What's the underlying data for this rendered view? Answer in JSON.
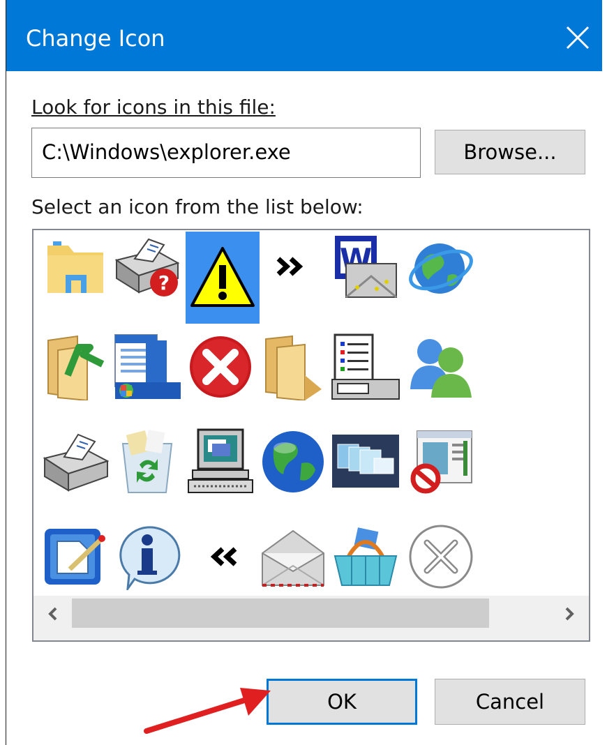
{
  "dialog": {
    "title": "Change Icon",
    "look_for_label": "Look for icons in this file:",
    "file_path": "C:\\Windows\\explorer.exe",
    "browse_label": "Browse...",
    "select_label": "Select an icon from the list below:",
    "ok_label": "OK",
    "cancel_label": "Cancel"
  },
  "icons": [
    [
      "folder-navigation-icon",
      "printer-help-icon",
      "warning-icon",
      "forward-double-chevron-icon",
      "word-document-icon",
      "internet-globe-icon"
    ],
    [
      "folder-upload-icon",
      "start-menu-icon",
      "error-icon",
      "folder-open-icon",
      "system-properties-icon",
      "users-icon"
    ],
    [
      "printer-icon",
      "recycle-bin-icon",
      "computer-icon",
      "globe-icon",
      "windows-switcher-icon",
      "blocked-window-icon"
    ],
    [
      "document-edit-icon",
      "information-icon",
      "back-double-chevron-icon",
      "mail-envelope-icon",
      "shopping-basket-icon",
      "close-circle-icon"
    ]
  ],
  "selected_icon": "warning-icon",
  "colors": {
    "title_bar": "#0078d7",
    "selection": "#3a8fef",
    "annotation_arrow": "#e02020"
  }
}
